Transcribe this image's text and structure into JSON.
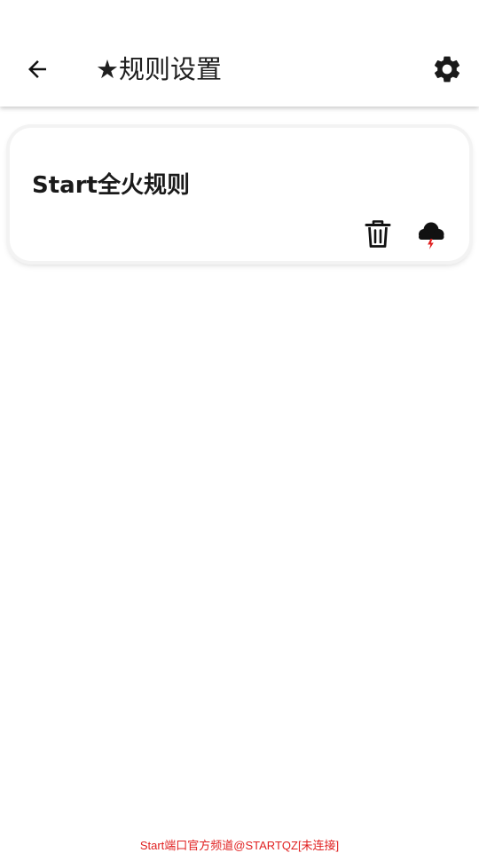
{
  "header": {
    "back_icon": "arrow-back-icon",
    "title": "★规则设置",
    "settings_icon": "gear-icon"
  },
  "rules": [
    {
      "name": "Start全火规则",
      "delete_icon": "trash-icon",
      "cloud_icon": "cloud-lightning-icon"
    }
  ],
  "footer": {
    "text": "Start端口官方频道@STARTQZ[未连接]",
    "color": "#e02020"
  },
  "colors": {
    "accent_red": "#e02020",
    "icon": "#111111",
    "text": "#1a1a1a"
  }
}
